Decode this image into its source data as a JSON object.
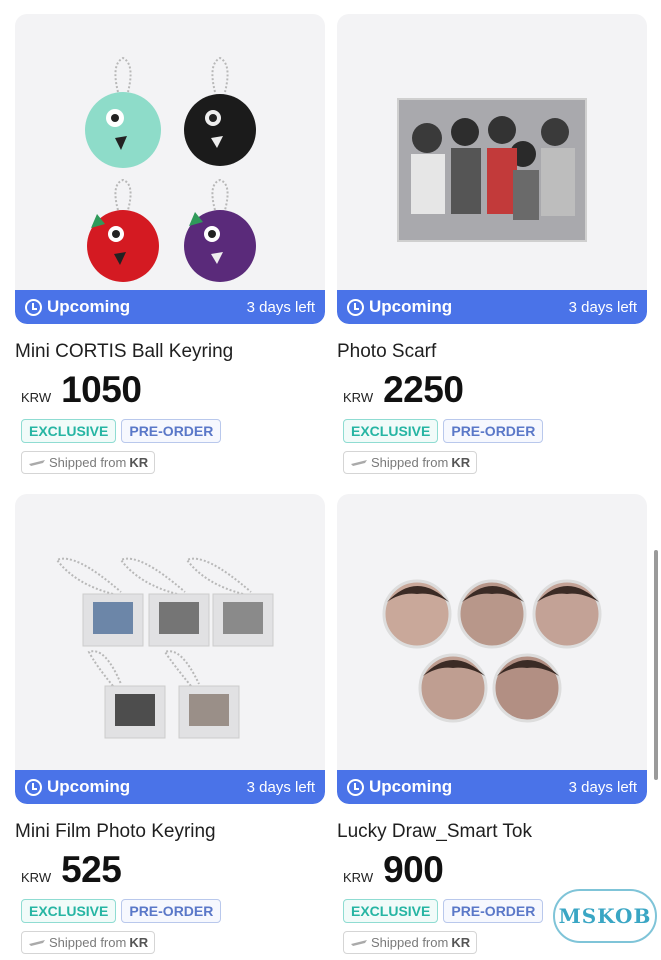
{
  "products": [
    {
      "name": "Mini CORTIS Ball Keyring",
      "currency": "KRW",
      "price": "1050",
      "status": "Upcoming",
      "time_left": "3 days left",
      "tags": [
        "EXCLUSIVE",
        "PRE-ORDER"
      ],
      "ship_prefix": "Shipped from",
      "ship_origin": "KR"
    },
    {
      "name": "Photo Scarf",
      "currency": "KRW",
      "price": "2250",
      "status": "Upcoming",
      "time_left": "3 days left",
      "tags": [
        "EXCLUSIVE",
        "PRE-ORDER"
      ],
      "ship_prefix": "Shipped from",
      "ship_origin": "KR"
    },
    {
      "name": "Mini Film Photo Keyring",
      "currency": "KRW",
      "price": "525",
      "status": "Upcoming",
      "time_left": "3 days left",
      "tags": [
        "EXCLUSIVE",
        "PRE-ORDER"
      ],
      "ship_prefix": "Shipped from",
      "ship_origin": "KR"
    },
    {
      "name": "Lucky Draw_Smart Tok",
      "currency": "KRW",
      "price": "900",
      "status": "Upcoming",
      "time_left": "3 days left",
      "tags": [
        "EXCLUSIVE",
        "PRE-ORDER"
      ],
      "ship_prefix": "Shipped from",
      "ship_origin": "KR"
    }
  ],
  "watermark": "MSKOB",
  "colors": {
    "banner": "#4a73e8",
    "exclusive": "#26b5a3",
    "preorder": "#5a78c8"
  },
  "icons": {
    "status": "clock-icon",
    "shipping": "airplane-icon"
  }
}
